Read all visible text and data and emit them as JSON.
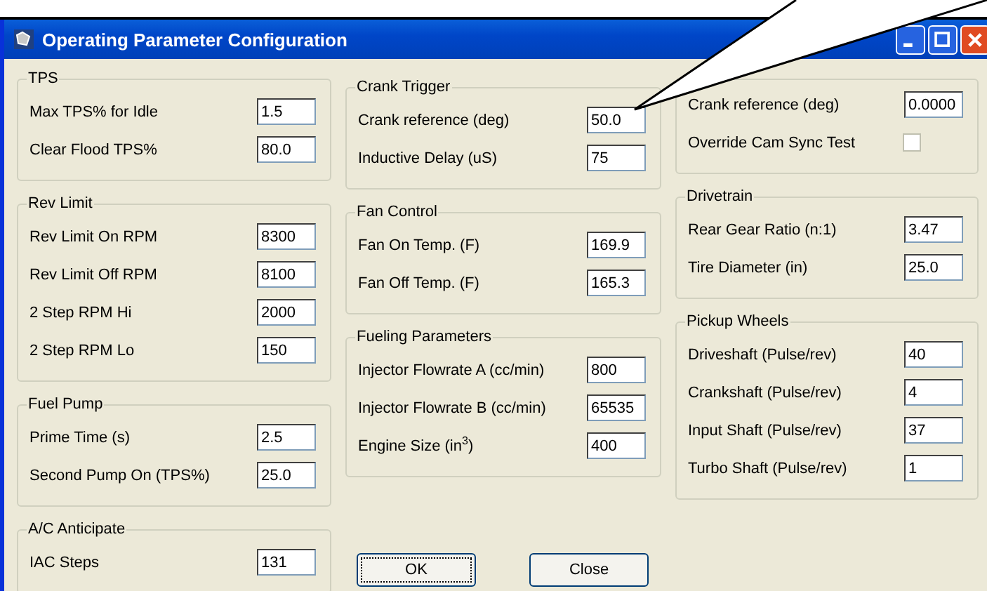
{
  "window": {
    "title": "Operating Parameter Configuration"
  },
  "columns": [
    {
      "groups": [
        {
          "title": "TPS",
          "rows": [
            {
              "kind": "text",
              "label": "Max TPS% for Idle",
              "value": "1.5"
            },
            {
              "kind": "text",
              "label": "Clear Flood TPS%",
              "value": "80.0"
            }
          ]
        },
        {
          "title": "Rev Limit",
          "rows": [
            {
              "kind": "text",
              "label": "Rev Limit On RPM",
              "value": "8300"
            },
            {
              "kind": "text",
              "label": "Rev Limit Off RPM",
              "value": "8100"
            },
            {
              "kind": "text",
              "label": "2 Step RPM Hi",
              "value": "2000"
            },
            {
              "kind": "text",
              "label": "2 Step RPM Lo",
              "value": "150"
            }
          ]
        },
        {
          "title": "Fuel Pump",
          "rows": [
            {
              "kind": "text",
              "label": "Prime Time (s)",
              "value": "2.5"
            },
            {
              "kind": "text",
              "label": "Second Pump On (TPS%)",
              "value": "25.0"
            }
          ]
        },
        {
          "title": "A/C Anticipate",
          "rows": [
            {
              "kind": "text",
              "label": "IAC Steps",
              "value": "131"
            }
          ]
        }
      ]
    },
    {
      "groups": [
        {
          "title": "Crank Trigger",
          "rows": [
            {
              "kind": "text",
              "label": "Crank reference (deg)",
              "value": "50.0"
            },
            {
              "kind": "text",
              "label": "Inductive Delay (uS)",
              "value": "75"
            }
          ]
        },
        {
          "title": "Fan Control",
          "rows": [
            {
              "kind": "text",
              "label": "Fan On Temp. (F)",
              "value": "169.9"
            },
            {
              "kind": "text",
              "label": "Fan Off Temp. (F)",
              "value": "165.3"
            }
          ]
        },
        {
          "title": "Fueling Parameters",
          "rows": [
            {
              "kind": "text",
              "label": "Injector Flowrate A (cc/min)",
              "value": "800"
            },
            {
              "kind": "text",
              "label": "Injector Flowrate B (cc/min)",
              "value": "65535"
            },
            {
              "kind": "text",
              "label": "Engine Size (in$^{3}$)",
              "value": "400"
            }
          ]
        }
      ]
    },
    {
      "groups": [
        {
          "rows": [
            {
              "kind": "text",
              "label": "Crank reference (deg)",
              "value": "0.0000"
            },
            {
              "kind": "checkbox",
              "label": "Override Cam Sync Test",
              "checked": false
            }
          ]
        },
        {
          "title": "Drivetrain",
          "rows": [
            {
              "kind": "text",
              "label": "Rear Gear Ratio (n:1)",
              "value": "3.47"
            },
            {
              "kind": "text",
              "label": "Tire Diameter (in)",
              "value": "25.0"
            }
          ]
        },
        {
          "title": "Pickup Wheels",
          "rows": [
            {
              "kind": "text",
              "label": "Driveshaft (Pulse/rev)",
              "value": "40"
            },
            {
              "kind": "text",
              "label": "Crankshaft (Pulse/rev)",
              "value": "4"
            },
            {
              "kind": "text",
              "label": "Input Shaft (Pulse/rev)",
              "value": "37"
            },
            {
              "kind": "text",
              "label": "Turbo Shaft (Pulse/rev)",
              "value": "1"
            }
          ]
        }
      ]
    }
  ],
  "buttons": [
    {
      "label": "OK",
      "focused": true
    },
    {
      "label": "Close",
      "focused": false
    }
  ]
}
